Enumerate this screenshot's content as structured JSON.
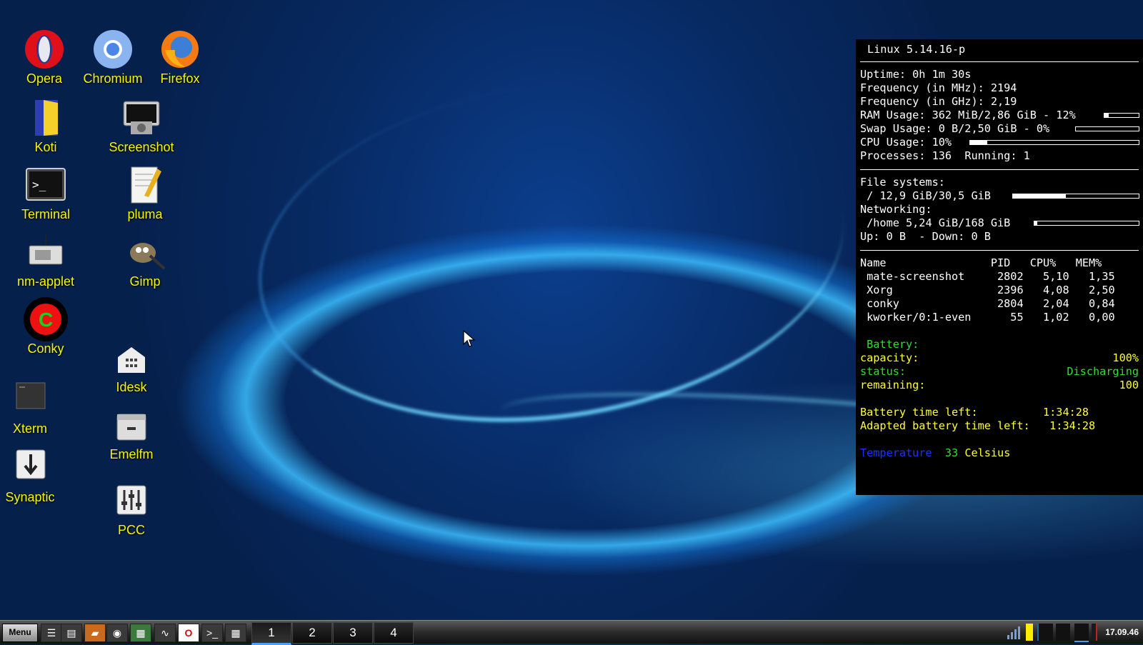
{
  "desktop_icons": [
    {
      "label": "Opera",
      "icon": "opera-icon"
    },
    {
      "label": "Chromium",
      "icon": "chromium-icon"
    },
    {
      "label": "Firefox",
      "icon": "firefox-icon"
    },
    {
      "label": "Koti",
      "icon": "home-folder-icon"
    },
    {
      "label": "Screenshot",
      "icon": "camera-icon"
    },
    {
      "label": "Terminal",
      "icon": "terminal-icon"
    },
    {
      "label": "pluma",
      "icon": "text-editor-icon"
    },
    {
      "label": "nm-applet",
      "icon": "network-icon"
    },
    {
      "label": "Gimp",
      "icon": "gimp-icon"
    },
    {
      "label": "Conky",
      "icon": "conky-icon"
    },
    {
      "label": "Idesk",
      "icon": "grid-home-icon"
    },
    {
      "label": "Xterm",
      "icon": "xterm-icon"
    },
    {
      "label": "Emelfm",
      "icon": "file-manager-icon"
    },
    {
      "label": "Synaptic",
      "icon": "download-icon"
    },
    {
      "label": "PCC",
      "icon": "sliders-icon"
    }
  ],
  "conky": {
    "kernel": "Linux 5.14.16-p",
    "uptime_label": "Uptime: ",
    "uptime": "0h 1m 30s",
    "freq_mhz_label": "Frequency (in MHz): ",
    "freq_mhz": "2194",
    "freq_ghz_label": "Frequency (in GHz): ",
    "freq_ghz": "2,19",
    "ram_label": "RAM Usage: ",
    "ram": "362 MiB/2,86 GiB - 12%",
    "ram_fraction": 0.12,
    "swap_label": "Swap Usage: ",
    "swap": "0 B/2,50 GiB - 0%",
    "swap_fraction": 0.0,
    "cpu_label": "CPU Usage: ",
    "cpu": "10%",
    "cpu_fraction": 0.1,
    "proc_label": "Processes: ",
    "processes": "136",
    "running_label": "  Running: ",
    "running": "1",
    "fs_title": "File systems:",
    "root_label": " / ",
    "root": "12,9 GiB/30,5 GiB",
    "root_fraction": 0.42,
    "net_title": "Networking:",
    "home_label": " /home ",
    "home": "5,24 GiB/168 GiB",
    "home_fraction": 0.03,
    "updown": "Up: 0 B  - Down: 0 B",
    "proc_header": "Name                PID   CPU%   MEM%",
    "procs": [
      " mate-screenshot     2802   5,10   1,35",
      " Xorg                2396   4,08   2,50",
      " conky               2804   2,04   0,84",
      " kworker/0:1-even      55   1,02   0,00"
    ],
    "battery_title": " Battery:",
    "capacity_label": "capacity:",
    "capacity": "100%",
    "status_label": "status:",
    "status": "Discharging",
    "remaining_label": "remaining:",
    "remaining": "100",
    "time_left": "Battery time left:          1:34:28",
    "adapted_time_left": "Adapted battery time left:   1:34:28",
    "temp_label": "Temperature",
    "temp_value": "33",
    "temp_unit": "Celsius"
  },
  "taskbar": {
    "menu_label": "Menu",
    "workspaces": [
      "1",
      "2",
      "3",
      "4"
    ],
    "active_workspace": 0,
    "clock": "17.09.46",
    "quicklaunch": [
      "window-list-icon",
      "show-desktop-icon",
      "file-manager-icon",
      "webcam-icon",
      "network-map-icon",
      "system-monitor-icon",
      "opera-icon",
      "terminal-icon",
      "grid-icon"
    ]
  }
}
